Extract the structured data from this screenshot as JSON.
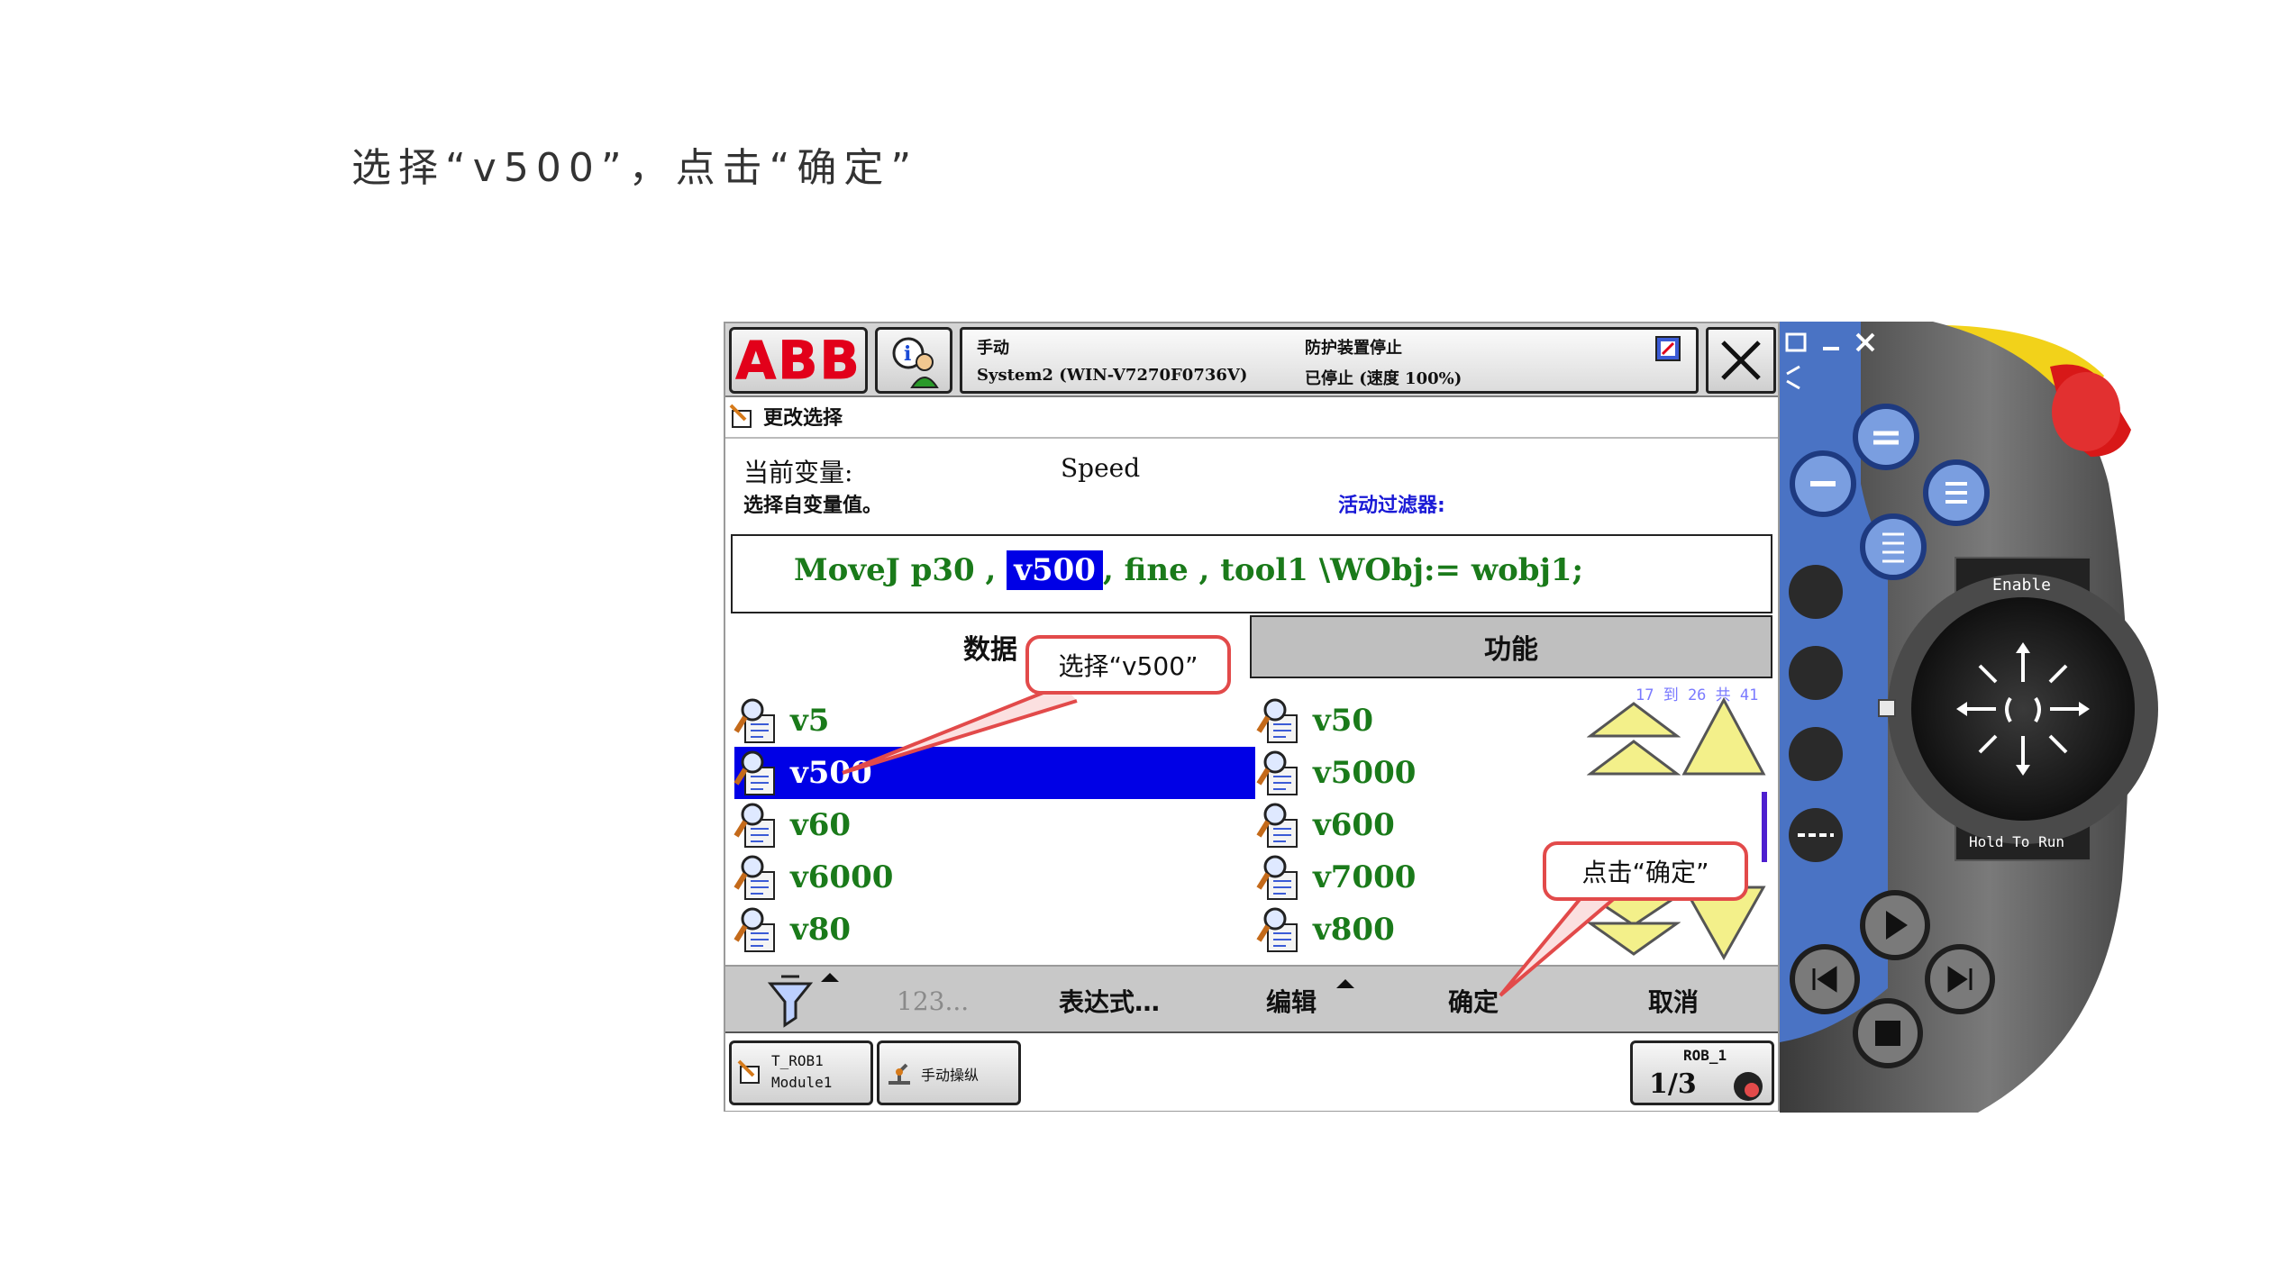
{
  "instruction": "选择“v500”，点击“确定”",
  "topbar": {
    "logo_text": "ABB",
    "mode": "手动",
    "system": "System2 (WIN-V7270F0736V)",
    "guard": "防护装置停止",
    "state": "已停止 (速度 100%)"
  },
  "subheader": {
    "title": "更改选择"
  },
  "variable": {
    "current_label": "当前变量:",
    "current_value": "Speed",
    "select_hint": "选择自变量值。",
    "filter_label": "活动过滤器:"
  },
  "code": {
    "before": "MoveJ p30 , ",
    "highlight": "v500",
    "after": ", fine , tool1 \\WObj:= wobj1;"
  },
  "tabs": {
    "data": "数据",
    "functions": "功能"
  },
  "range_info": "17 到 26 共 41",
  "items_left": [
    "v5",
    "v500",
    "v60",
    "v6000",
    "v80"
  ],
  "items_right": [
    "v50",
    "v5000",
    "v600",
    "v7000",
    "v800"
  ],
  "selected_item": "v500",
  "bottombar": {
    "numeric": "123...",
    "expression": "表达式…",
    "edit": "编辑",
    "ok": "确定",
    "cancel": "取消"
  },
  "taskbar": {
    "task1_line1": "T_ROB1",
    "task1_line2": "Module1",
    "task2": "手动操纵",
    "rob_label": "ROB_1",
    "rob_fraction": "1/3"
  },
  "callouts": {
    "select": "选择“v500”",
    "click": "点击“确定”"
  },
  "hardware": {
    "enable": "Enable",
    "hold_to_run": "Hold To Run"
  },
  "colors": {
    "selection_blue": "#0000e6",
    "code_green": "#1a7a1a",
    "callout_red": "#e24a4a",
    "abb_red": "#e2001a",
    "filter_blue": "#1a1ad6"
  }
}
